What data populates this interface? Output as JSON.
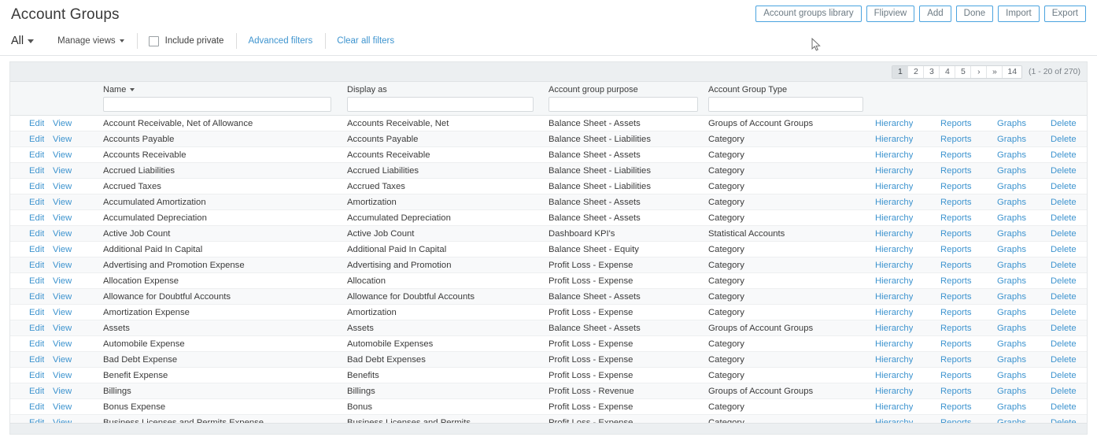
{
  "header": {
    "title": "Account Groups",
    "buttons": [
      {
        "label": "Account groups library",
        "name": "account-groups-library-button"
      },
      {
        "label": "Flipview",
        "name": "flipview-button"
      },
      {
        "label": "Add",
        "name": "add-button"
      },
      {
        "label": "Done",
        "name": "done-button"
      },
      {
        "label": "Import",
        "name": "import-button"
      },
      {
        "label": "Export",
        "name": "export-button"
      }
    ]
  },
  "toolbar": {
    "view_selector": "All",
    "manage_views": "Manage views",
    "include_private": "Include private",
    "advanced_filters": "Advanced filters",
    "clear_all_filters": "Clear all filters"
  },
  "pagination": {
    "pages": [
      "1",
      "2",
      "3",
      "4",
      "5",
      "›",
      "»",
      "14"
    ],
    "active_index": 0,
    "count_text": "(1 - 20 of 270)"
  },
  "grid": {
    "columns": [
      {
        "label": "Name",
        "sorted": true
      },
      {
        "label": "Display as",
        "sorted": false
      },
      {
        "label": "Account group purpose",
        "sorted": false
      },
      {
        "label": "Account Group Type",
        "sorted": false
      }
    ],
    "filter_values": [
      "",
      "",
      "",
      ""
    ],
    "row_actions_left": [
      "Edit",
      "View"
    ],
    "row_actions_right": [
      "Hierarchy",
      "Reports",
      "Graphs",
      "Delete"
    ],
    "rows": [
      {
        "name": "Account Receivable, Net of Allowance",
        "display_as": "Accounts Receivable, Net",
        "purpose": "Balance Sheet - Assets",
        "type": "Groups of Account Groups"
      },
      {
        "name": "Accounts Payable",
        "display_as": "Accounts Payable",
        "purpose": "Balance Sheet - Liabilities",
        "type": "Category"
      },
      {
        "name": "Accounts Receivable",
        "display_as": "Accounts Receivable",
        "purpose": "Balance Sheet - Assets",
        "type": "Category"
      },
      {
        "name": "Accrued Liabilities",
        "display_as": "Accrued Liabilities",
        "purpose": "Balance Sheet - Liabilities",
        "type": "Category"
      },
      {
        "name": "Accrued Taxes",
        "display_as": "Accrued Taxes",
        "purpose": "Balance Sheet - Liabilities",
        "type": "Category"
      },
      {
        "name": "Accumulated Amortization",
        "display_as": "Amortization",
        "purpose": "Balance Sheet - Assets",
        "type": "Category"
      },
      {
        "name": "Accumulated Depreciation",
        "display_as": "Accumulated Depreciation",
        "purpose": "Balance Sheet - Assets",
        "type": "Category"
      },
      {
        "name": "Active Job Count",
        "display_as": "Active Job Count",
        "purpose": "Dashboard KPI's",
        "type": "Statistical Accounts"
      },
      {
        "name": "Additional Paid In Capital",
        "display_as": "Additional Paid In Capital",
        "purpose": "Balance Sheet - Equity",
        "type": "Category"
      },
      {
        "name": "Advertising and Promotion Expense",
        "display_as": "Advertising and Promotion",
        "purpose": "Profit Loss - Expense",
        "type": "Category"
      },
      {
        "name": "Allocation Expense",
        "display_as": "Allocation",
        "purpose": "Profit Loss - Expense",
        "type": "Category"
      },
      {
        "name": "Allowance for Doubtful Accounts",
        "display_as": "Allowance for Doubtful Accounts",
        "purpose": "Balance Sheet - Assets",
        "type": "Category"
      },
      {
        "name": "Amortization Expense",
        "display_as": "Amortization",
        "purpose": "Profit Loss - Expense",
        "type": "Category"
      },
      {
        "name": "Assets",
        "display_as": "Assets",
        "purpose": "Balance Sheet - Assets",
        "type": "Groups of Account Groups"
      },
      {
        "name": "Automobile Expense",
        "display_as": "Automobile Expenses",
        "purpose": "Profit Loss - Expense",
        "type": "Category"
      },
      {
        "name": "Bad Debt Expense",
        "display_as": "Bad Debt Expenses",
        "purpose": "Profit Loss - Expense",
        "type": "Category"
      },
      {
        "name": "Benefit Expense",
        "display_as": "Benefits",
        "purpose": "Profit Loss - Expense",
        "type": "Category"
      },
      {
        "name": "Billings",
        "display_as": "Billings",
        "purpose": "Profit Loss - Revenue",
        "type": "Groups of Account Groups"
      },
      {
        "name": "Bonus Expense",
        "display_as": "Bonus",
        "purpose": "Profit Loss - Expense",
        "type": "Category"
      },
      {
        "name": "Business Licenses and Permits Expense",
        "display_as": "Business Licenses and Permits",
        "purpose": "Profit Loss - Expense",
        "type": "Category"
      }
    ]
  },
  "colors": {
    "link": "#3e94cf",
    "button_border": "#4aa3df",
    "header_band": "#eceff1",
    "filter_band": "#f5f7f8",
    "row_alt": "#f8f9fa"
  }
}
